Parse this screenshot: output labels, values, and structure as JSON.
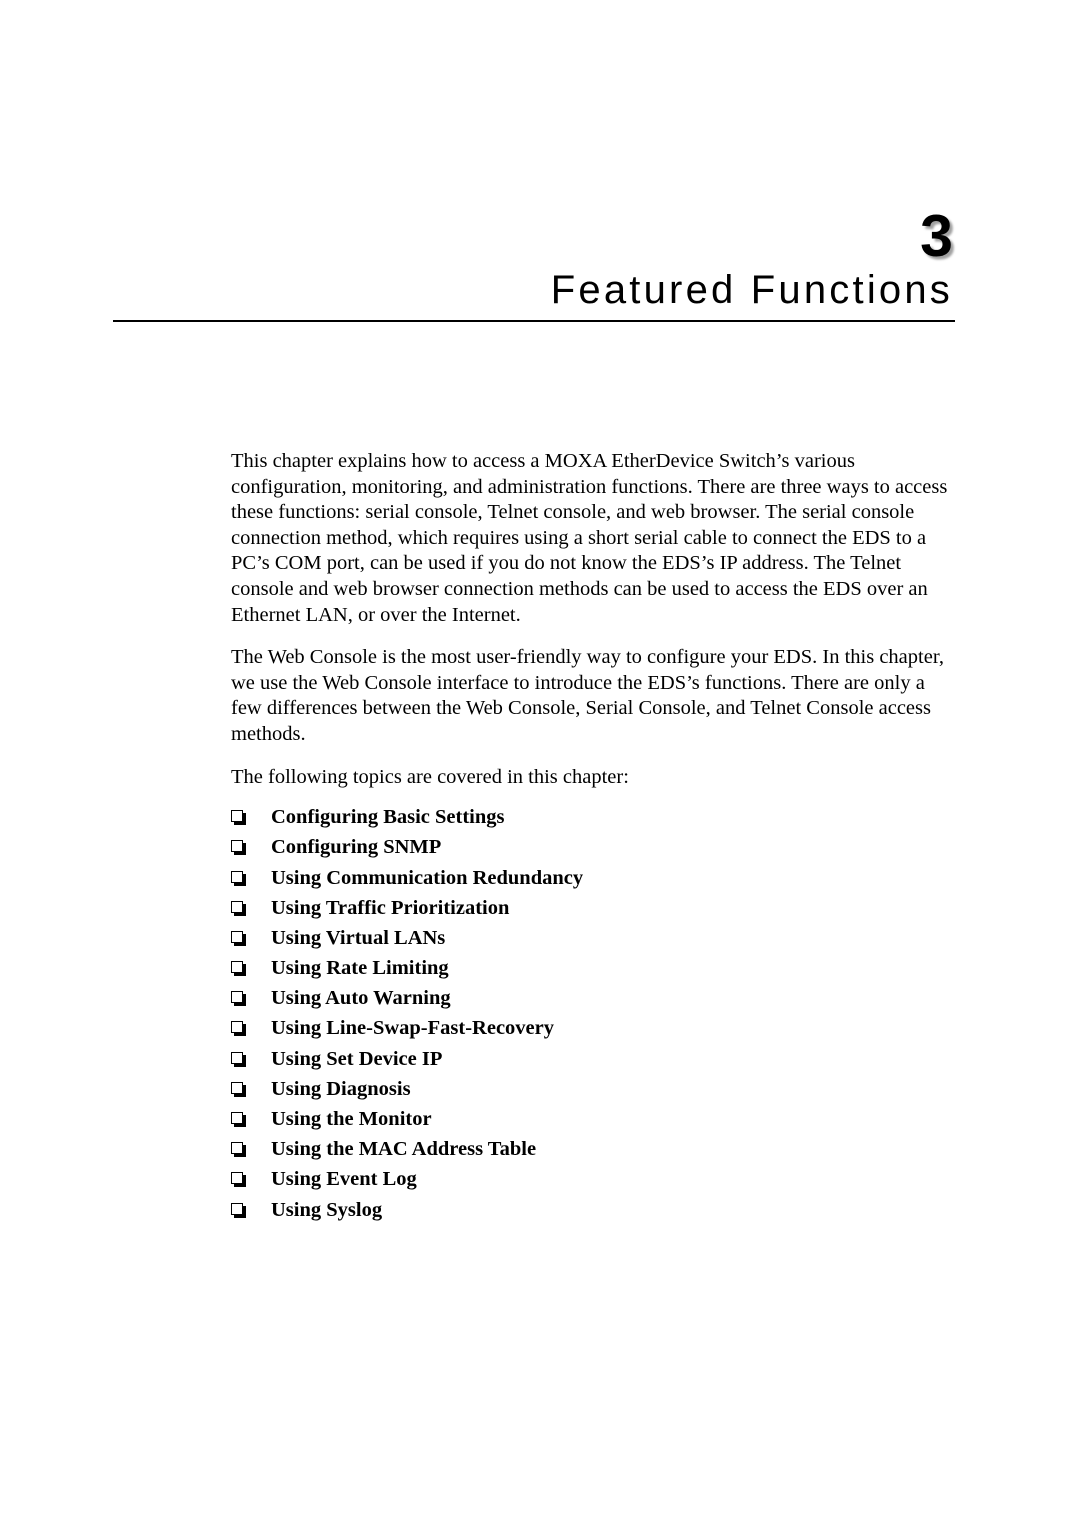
{
  "chapter": {
    "number": "3",
    "title": "Featured Functions"
  },
  "body": {
    "paragraph_1": "This chapter explains how to access a MOXA EtherDevice Switch’s various configuration, monitoring, and administration functions. There are three ways to access these functions: serial console, Telnet console, and web browser. The serial console connection method, which requires using a short serial cable to connect the EDS to a PC’s COM port, can be used if you do not know the EDS’s IP address. The Telnet console and web browser connection methods can be used to access the EDS over an Ethernet LAN, or over the Internet.",
    "paragraph_2": "The Web Console is the most user-friendly way to configure your EDS. In this chapter, we use the Web Console interface to introduce the EDS’s functions. There are only a few differences between the Web Console, Serial Console, and Telnet Console access methods.",
    "topics_intro": "The following topics are covered in this chapter:"
  },
  "topics": [
    {
      "label": "Configuring Basic Settings",
      "bullet": "checkbox-square-bullet-icon"
    },
    {
      "label": "Configuring SNMP",
      "bullet": "checkbox-square-bullet-icon"
    },
    {
      "label": "Using Communication Redundancy",
      "bullet": "checkbox-square-bullet-icon"
    },
    {
      "label": "Using Traffic Prioritization",
      "bullet": "checkbox-square-bullet-icon"
    },
    {
      "label": "Using Virtual LANs",
      "bullet": "checkbox-square-bullet-icon"
    },
    {
      "label": "Using Rate Limiting",
      "bullet": "checkbox-square-bullet-icon"
    },
    {
      "label": "Using Auto Warning",
      "bullet": "checkbox-square-bullet-icon"
    },
    {
      "label": "Using Line-Swap-Fast-Recovery",
      "bullet": "checkbox-square-bullet-icon"
    },
    {
      "label": "Using Set Device IP",
      "bullet": "checkbox-square-bullet-icon"
    },
    {
      "label": "Using Diagnosis",
      "bullet": "checkbox-square-bullet-icon"
    },
    {
      "label": "Using the Monitor",
      "bullet": "checkbox-square-bullet-icon"
    },
    {
      "label": "Using the MAC Address Table",
      "bullet": "checkbox-square-bullet-icon"
    },
    {
      "label": "Using Event Log",
      "bullet": "checkbox-square-bullet-icon"
    },
    {
      "label": "Using Syslog",
      "bullet": "checkbox-square-bullet-icon"
    }
  ],
  "colors": {
    "text": "#000000",
    "page_background": "#ffffff",
    "rule": "#000000",
    "number_shadow": "#828282"
  }
}
